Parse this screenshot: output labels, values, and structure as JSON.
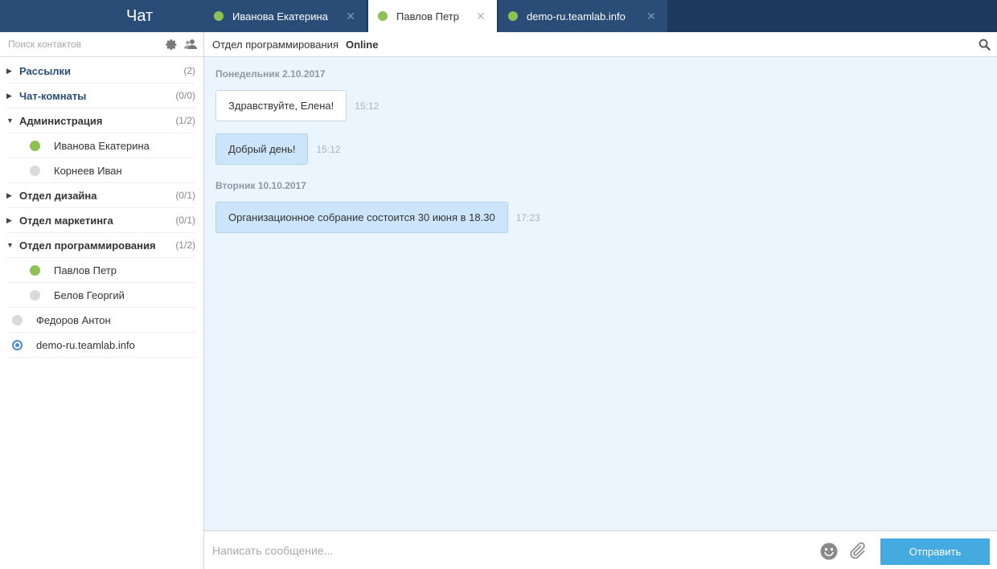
{
  "app": {
    "title": "Чат"
  },
  "tabs": [
    {
      "label": "Иванова Екатерина",
      "close": "✕",
      "active": false
    },
    {
      "label": "Павлов Петр",
      "close": "✕",
      "active": true
    },
    {
      "label": "demo-ru.teamlab.info",
      "close": "✕",
      "active": false
    }
  ],
  "sidebar": {
    "search_placeholder": "Поиск контактов",
    "icons": [
      "gear-icon",
      "users-icon"
    ],
    "groups": [
      {
        "label": "Рассылки",
        "count": "(2)",
        "expanded": false
      },
      {
        "label": "Чат-комнаты",
        "count": "(0/0)",
        "expanded": false
      },
      {
        "label": "Администрация",
        "count": "(1/2)",
        "expanded": true,
        "contacts": [
          {
            "name": "Иванова Екатерина",
            "status": "online"
          },
          {
            "name": "Корнеев Иван",
            "status": "offline"
          }
        ]
      },
      {
        "label": "Отдел дизайна",
        "count": "(0/1)",
        "expanded": false
      },
      {
        "label": "Отдел маркетинга",
        "count": "(0/1)",
        "expanded": false
      },
      {
        "label": "Отдел программирования",
        "count": "(1/2)",
        "expanded": true,
        "contacts": [
          {
            "name": "Павлов Петр",
            "status": "online"
          },
          {
            "name": "Белов Георгий",
            "status": "offline"
          }
        ]
      }
    ],
    "root_contacts": [
      {
        "name": "Федоров Антон",
        "status": "offline"
      },
      {
        "name": "demo-ru.teamlab.info",
        "status": "server"
      }
    ]
  },
  "chat": {
    "group": "Отдел программирования",
    "status": "Online",
    "days": [
      {
        "date": "Понедельник 2.10.2017",
        "messages": [
          {
            "text": "Здравствуйте, Елена!",
            "time": "15:12",
            "mine": false
          },
          {
            "text": "Добрый день!",
            "time": "15:12",
            "mine": true
          }
        ]
      },
      {
        "date": "Вторник 10.10.2017",
        "messages": [
          {
            "text": "Организационное собрание состоится 30 июня в 18.30",
            "time": "17:23",
            "mine": true
          }
        ]
      }
    ]
  },
  "composer": {
    "placeholder": "Написать сообщение...",
    "send_label": "Отправить"
  },
  "colors": {
    "topbar": "#1d3b5f",
    "tab": "#2a4d77",
    "online": "#8dc152",
    "chat_bg": "#eaf5fd",
    "send": "#45aae0"
  }
}
